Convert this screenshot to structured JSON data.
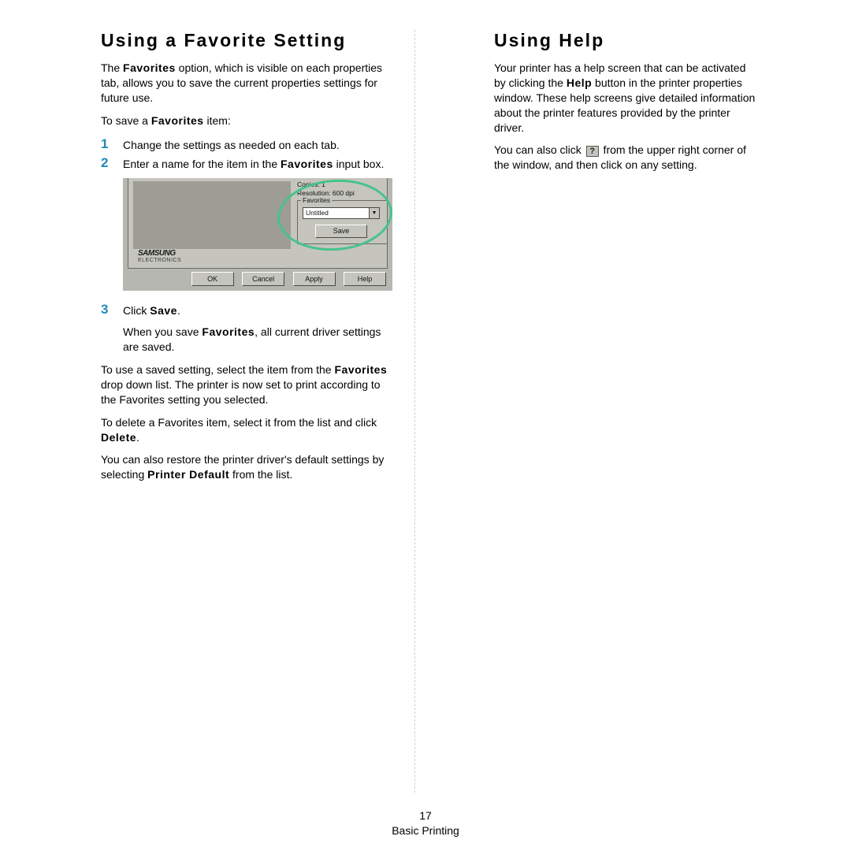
{
  "page_number": "17",
  "footer_section": "Basic Printing",
  "left": {
    "title": "Using a Favorite Setting",
    "intro_a": "The ",
    "intro_b": "Favorites",
    "intro_c": " option, which is visible on each properties tab, allows you to save the current properties settings for future use.",
    "to_save_a": "To save a ",
    "to_save_b": "Favorites",
    "to_save_c": " item:",
    "steps": {
      "s1_num": "1",
      "s1_txt": "Change the settings as needed on each tab.",
      "s2_num": "2",
      "s2_txt_a": "Enter a name for the item in the ",
      "s2_txt_b": "Favorites",
      "s2_txt_c": " input box.",
      "s3_num": "3",
      "s3_txt_a": "Click ",
      "s3_txt_b": "Save",
      "s3_txt_c": ".",
      "s3_body_a": "When you save ",
      "s3_body_b": "Favorites",
      "s3_body_c": ", all current driver settings are saved."
    },
    "use_a": "To use a saved setting, select the item from the ",
    "use_b": "Favorites",
    "use_c": " drop down list. The printer is now set to print according to the Favorites setting you selected.",
    "del_a": "To delete a Favorites item, select it from the list and click ",
    "del_b": "Delete",
    "del_c": ".",
    "restore_a": "You can also restore the printer driver's default settings by selecting ",
    "restore_b": "Printer Default",
    "restore_c": " from the list."
  },
  "dialog": {
    "copies": "Copies: 1",
    "resolution": "Resolution: 600 dpi",
    "favorites_label": "Favorites",
    "favorites_value": "Untitled",
    "save": "Save",
    "brand": "SAMSUNG",
    "brand_sub": "ELECTRONICS",
    "ok": "OK",
    "cancel": "Cancel",
    "apply": "Apply",
    "help": "Help"
  },
  "right": {
    "title": "Using Help",
    "p1_a": "Your printer has a help screen that can be activated by clicking the ",
    "p1_b": "Help",
    "p1_c": " button in the printer properties window. These help screens give detailed information about the printer features provided by the printer driver.",
    "p2_a": "You can also click ",
    "p2_icon": "?",
    "p2_b": " from the upper right corner of the window, and then click on any setting."
  }
}
